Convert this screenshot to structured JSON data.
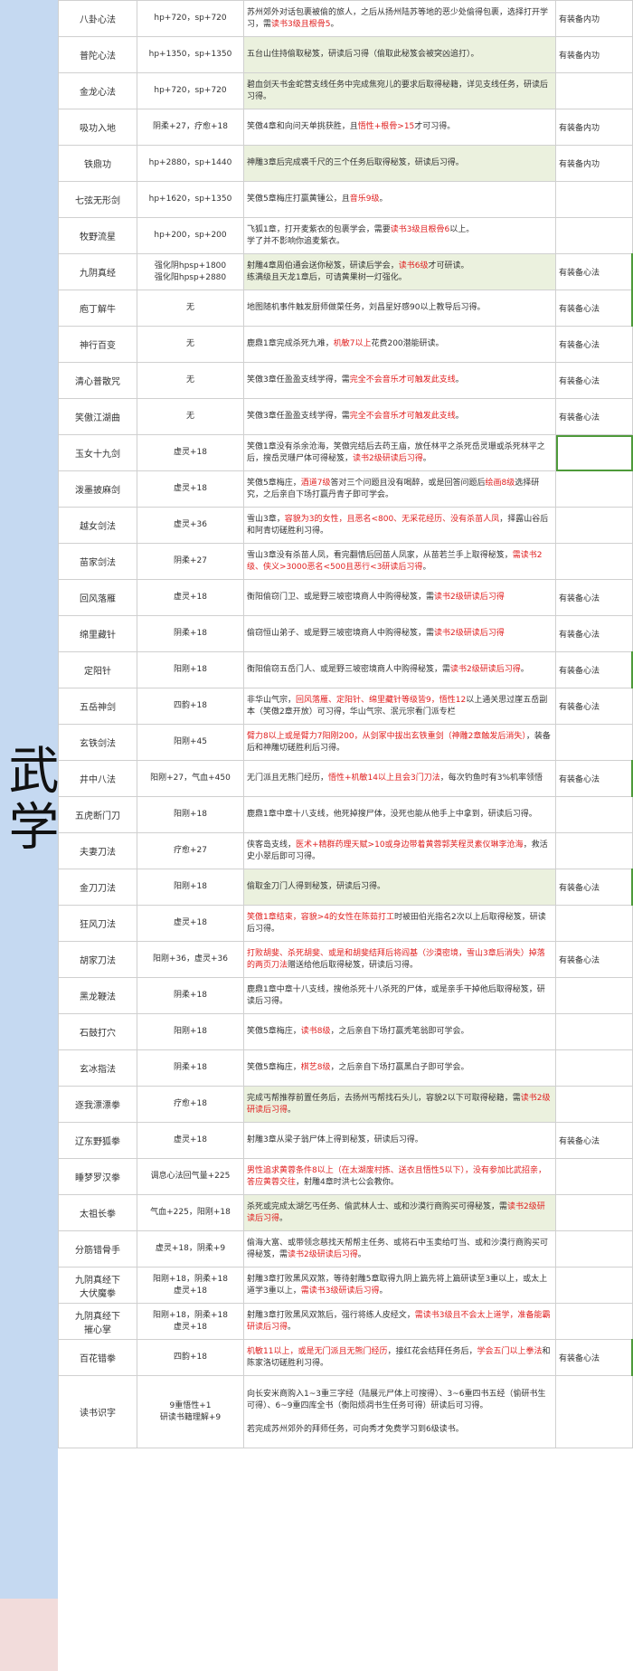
{
  "category_label": "武学",
  "rows": [
    {
      "name": "八卦心法",
      "attr": "hp+720，sp+720",
      "desc": [
        [
          "苏州郊外对话包裹被偷的旅人，之后从扬州陆苏等地的恶少处偷得包裹，选择打开学习，需",
          ""
        ],
        [
          "读书3级且根骨5",
          "r"
        ],
        [
          "。",
          ""
        ]
      ],
      "eq": "有装备内功",
      "g": false
    },
    {
      "name": "普陀心法",
      "attr": "hp+1350，sp+1350",
      "desc": [
        [
          "五台山住持偷取秘笈，研读后习得（偷取此秘笈会被突凶追打）。",
          ""
        ]
      ],
      "eq": "有装备内功",
      "g": true
    },
    {
      "name": "金龙心法",
      "attr": "hp+720，sp+720",
      "desc": [
        [
          "碧血剑天书金蛇营支线任务中完成焦宛儿的要求后取得秘籍，详见支线任务，研读后习得。",
          ""
        ]
      ],
      "eq": "",
      "g": true
    },
    {
      "name": "吸功入地",
      "attr": "阴柔+27，疗愈+18",
      "desc": [
        [
          "笑傲4章和向问天单挑获胜，且",
          ""
        ],
        [
          "悟性+根骨>15",
          "r"
        ],
        [
          "才可习得。",
          ""
        ]
      ],
      "eq": "有装备内功",
      "g": false
    },
    {
      "name": "铁鼎功",
      "attr": "hp+2880，sp+1440",
      "desc": [
        [
          "神雕3章后完成裘千尺的三个任务后取得秘笈，研读后习得。",
          ""
        ]
      ],
      "eq": "有装备内功",
      "g": true
    },
    {
      "name": "七弦无形剑",
      "attr": "hp+1620，sp+1350",
      "desc": [
        [
          "笑傲5章梅庄打赢黄锺公，且",
          ""
        ],
        [
          "音乐9级",
          "r"
        ],
        [
          "。",
          ""
        ]
      ],
      "eq": "",
      "g": false
    },
    {
      "name": "牧野流星",
      "attr": "hp+200，sp+200",
      "desc": [
        [
          "飞狐1章，打开麦紫衣的包裹学会，需要",
          ""
        ],
        [
          "读书3级且根骨6",
          "r"
        ],
        [
          "以上。",
          ""
        ],
        [
          "\n学了并不影响你追麦紫衣。",
          ""
        ]
      ],
      "eq": "",
      "g": false
    },
    {
      "name": "九阴真经",
      "attr": "强化阴hpsp+1800\n强化阳hpsp+2880",
      "desc": [
        [
          "射雕4章周伯通会送你秘笈，研读后学会，",
          ""
        ],
        [
          "读书6级",
          "r"
        ],
        [
          "才可研读。\n练满级且天龙1章后，可请黄果树一灯强化。",
          ""
        ]
      ],
      "eq": "有装备心法",
      "g": true,
      "mk": true
    },
    {
      "name": "庖丁解牛",
      "attr": "无",
      "desc": [
        [
          "地图随机事件触发厨师做菜任务，刘昌星好感90以上教导后习得。",
          ""
        ]
      ],
      "eq": "有装备心法",
      "g": false,
      "mk": true
    },
    {
      "name": "神行百变",
      "attr": "无",
      "desc": [
        [
          "鹿鼎1章完成杀死九难，",
          ""
        ],
        [
          "机敏7以上",
          "r"
        ],
        [
          "花费200潜能研读。",
          ""
        ]
      ],
      "eq": "有装备心法",
      "g": false
    },
    {
      "name": "清心普散咒",
      "attr": "无",
      "desc": [
        [
          "笑傲3章任盈盈支线学得，需",
          ""
        ],
        [
          "完全不会音乐才可触发此支线",
          "r"
        ],
        [
          "。",
          ""
        ]
      ],
      "eq": "有装备心法",
      "g": false
    },
    {
      "name": "笑傲江湖曲",
      "attr": "无",
      "desc": [
        [
          "笑傲3章任盈盈支线学得，需",
          ""
        ],
        [
          "完全不会音乐才可触发此支线",
          "r"
        ],
        [
          "。",
          ""
        ]
      ],
      "eq": "有装备心法",
      "g": false
    },
    {
      "name": "玉女十九剑",
      "attr": "虚灵+18",
      "desc": [
        [
          "笑傲1章没有杀余沧海，笑傲完结后去药王庙，放任林平之杀死岳灵珊或杀死林平之后，搜岳灵珊尸体可得秘笈，",
          ""
        ],
        [
          "读书2级研读后习得",
          "r"
        ],
        [
          "。",
          ""
        ]
      ],
      "eq": "",
      "g": false,
      "sel": true
    },
    {
      "name": "泼墨披麻剑",
      "attr": "虚灵+18",
      "desc": [
        [
          "笑傲5章梅庄，",
          ""
        ],
        [
          "酒道7级",
          "r"
        ],
        [
          "答对三个问题且没有喝醉，或是回答问题后",
          ""
        ],
        [
          "绘画8级",
          "r"
        ],
        [
          "选择研究，之后亲自下场打赢丹青子即可学会。",
          ""
        ]
      ],
      "eq": "",
      "g": false
    },
    {
      "name": "越女剑法",
      "attr": "虚灵+36",
      "desc": [
        [
          "雪山3章，",
          ""
        ],
        [
          "容貌为3的女性，且恶名<800、无采花经历、没有杀苗人凤",
          "r"
        ],
        [
          "，择露山谷后和阿青切磋胜利习得。",
          ""
        ]
      ],
      "eq": "",
      "g": false
    },
    {
      "name": "苗家剑法",
      "attr": "阴柔+27",
      "desc": [
        [
          "雪山3章没有杀苗人凤，看完翻情后回苗人凤家，从苗若兰手上取得秘笈，",
          ""
        ],
        [
          "需读书2级、侠义>3000恶名<500且恶行<3研读后习得",
          "r"
        ],
        [
          "。",
          ""
        ]
      ],
      "eq": "",
      "g": false
    },
    {
      "name": "回风落雁",
      "attr": "虚灵+18",
      "desc": [
        [
          "衡阳偷窃门卫、或是野三坡密境商人中购得秘笈，需",
          ""
        ],
        [
          "读书2级研读后习得",
          "r"
        ]
      ],
      "eq": "有装备心法",
      "g": false
    },
    {
      "name": "绵里藏针",
      "attr": "阴柔+18",
      "desc": [
        [
          "偷窃恒山弟子、或是野三坡密境商人中购得秘笈，需",
          ""
        ],
        [
          "读书2级研读后习得",
          "r"
        ]
      ],
      "eq": "有装备心法",
      "g": false
    },
    {
      "name": "定阳针",
      "attr": "阳刚+18",
      "desc": [
        [
          "衡阳偷窃五岳门人、或是野三坡密境商人中购得秘笈，需",
          ""
        ],
        [
          "读书2级研读后习得",
          "r"
        ],
        [
          "。",
          ""
        ]
      ],
      "eq": "有装备心法",
      "g": false,
      "mk": true
    },
    {
      "name": "五岳神剑",
      "attr": "四韵+18",
      "desc": [
        [
          "非华山气宗，",
          ""
        ],
        [
          "回风落雁、定阳针、绵里藏针等级皆9，悟性12",
          "r"
        ],
        [
          "以上通关思过崖五岳副本（笑傲2章开放）可习得，华山气宗、泯元宗看门派专栏",
          ""
        ]
      ],
      "eq": "有装备心法",
      "g": false
    },
    {
      "name": "玄铁剑法",
      "attr": "阳刚+45",
      "desc": [
        [
          "臂力8以上或是臂力7阳刚200，从剑冢中拔出玄铁重剑（神雕2章触发后消失）",
          "r"
        ],
        [
          "，装备后和神雕切磋胜利后习得。",
          ""
        ]
      ],
      "eq": "",
      "g": false
    },
    {
      "name": "井中八法",
      "attr": "阳刚+27，气血+450",
      "desc": [
        [
          "无门派且无熊门经历，",
          ""
        ],
        [
          "悟性+机敏14以上且会3门刀法",
          "r"
        ],
        [
          "，每次钓鱼时有3%机率领悟",
          ""
        ]
      ],
      "eq": "有装备心法",
      "g": false,
      "mk": true
    },
    {
      "name": "五虎断门刀",
      "attr": "阳刚+18",
      "desc": [
        [
          "鹿鼎1章中章十八支线，他死掉搜尸体，没死也能从他手上中拿到，研读后习得。",
          ""
        ]
      ],
      "eq": "",
      "g": false
    },
    {
      "name": "夫妻刀法",
      "attr": "疗愈+27",
      "desc": [
        [
          "侠客岛支线，",
          ""
        ],
        [
          "医术+精群药理天赋>10或身边带着黄蓉郭芙程灵素仪琳李沧海",
          "r"
        ],
        [
          "，救活史小翠后即可习得。",
          ""
        ]
      ],
      "eq": "",
      "g": false
    },
    {
      "name": "金刀刀法",
      "attr": "阳刚+18",
      "desc": [
        [
          "偷取金刀门人得到秘笈，研读后习得。",
          ""
        ]
      ],
      "eq": "有装备心法",
      "g": true,
      "mk": true
    },
    {
      "name": "狂风刀法",
      "attr": "虚灵+18",
      "desc": [
        [
          "笑傲1章结束，容貌>4的女性在陈茹打工",
          "r"
        ],
        [
          "时被田伯光指名2次以上后取得秘笈，研读后习得。",
          ""
        ]
      ],
      "eq": "",
      "g": false
    },
    {
      "name": "胡家刀法",
      "attr": "阳刚+36，虚灵+36",
      "desc": [
        [
          "打败胡斐、杀死胡斐、或是和胡斐结拜后将阎基（沙漠密境，雪山3章后消失）掉落的两页刀法",
          "r"
        ],
        [
          "赠送给他后取得秘笈，研读后习得。",
          ""
        ]
      ],
      "eq": "有装备心法",
      "g": false
    },
    {
      "name": "黑龙鞭法",
      "attr": "阴柔+18",
      "desc": [
        [
          "鹿鼎1章中章十八支线，搜他杀死十八杀死的尸体，或是亲手干掉他后取得秘笈，研读后习得。",
          ""
        ]
      ],
      "eq": "",
      "g": false
    },
    {
      "name": "石鼓打穴",
      "attr": "阳刚+18",
      "desc": [
        [
          "笑傲5章梅庄，",
          ""
        ],
        [
          "读书8级",
          "r"
        ],
        [
          "，之后亲自下场打赢秃笔翁即可学会。",
          ""
        ]
      ],
      "eq": "",
      "g": false
    },
    {
      "name": "玄冰指法",
      "attr": "阴柔+18",
      "desc": [
        [
          "笑傲5章梅庄，",
          ""
        ],
        [
          "棋艺8级",
          "r"
        ],
        [
          "，之后亲自下场打赢黑白子即可学会。",
          ""
        ]
      ],
      "eq": "",
      "g": false
    },
    {
      "name": "逐我漂漂拳",
      "attr": "疗愈+18",
      "desc": [
        [
          "完成丐帮推荐前置任务后，去扬州丐帮找石头儿，容貌2以下可取得秘籍，需",
          ""
        ],
        [
          "读书2级研读后习得",
          "r"
        ],
        [
          "。",
          ""
        ]
      ],
      "eq": "",
      "g": true
    },
    {
      "name": "辽东野狐拳",
      "attr": "虚灵+18",
      "desc": [
        [
          "射雕3章从梁子翁尸体上得到秘笈，研读后习得。",
          ""
        ]
      ],
      "eq": "有装备心法",
      "g": false
    },
    {
      "name": "睡梦罗汉拳",
      "attr": "调息心法回气量+225",
      "desc": [
        [
          "男性追求黄蓉条件8以上（在太湖废村拣、送衣且悟性5以下），没有参加比武招亲，答应黄蓉交往",
          "r"
        ],
        [
          "，射雕4章时洪七公会教你。",
          ""
        ]
      ],
      "eq": "",
      "g": false
    },
    {
      "name": "太祖长拳",
      "attr": "气血+225，阳刚+18",
      "desc": [
        [
          "杀死或完成太湖乞丐任务、偷武林人士、或和沙漠行商购买可得秘笈，需",
          ""
        ],
        [
          "读书2级研读后习得",
          "r"
        ],
        [
          "。",
          ""
        ]
      ],
      "eq": "",
      "g": true
    },
    {
      "name": "分筋错骨手",
      "attr": "虚灵+18，阴柔+9",
      "desc": [
        [
          "偷海大富、或带领念慈找天帮帮主任务、或将石中玉卖给叮当、或和沙漠行商购买可得秘笈，需",
          ""
        ],
        [
          "读书2级研读后习得",
          "r"
        ],
        [
          "。",
          ""
        ]
      ],
      "eq": "",
      "g": false
    },
    {
      "name": "九阴真经下\n大伏魔拳",
      "attr": "阳刚+18，阴柔+18\n虚灵+18",
      "desc": [
        [
          "射雕3章打败黑风双煞，等待射雕5章取得九阴上篇先将上篇研读至3重以上，或太上道学3重以上，",
          ""
        ],
        [
          "需读书3级研读后习得",
          "r"
        ],
        [
          "。",
          ""
        ]
      ],
      "eq": "",
      "g": false
    },
    {
      "name": "九阴真经下\n摧心掌",
      "attr": "阳刚+18，阴柔+18\n虚灵+18",
      "desc": [
        [
          "射雕3章打败黑风双煞后，强行将练人皮经文，",
          ""
        ],
        [
          "需读书3级且不会太上道学，准备能霸研读后习得",
          "r"
        ],
        [
          "。",
          ""
        ]
      ],
      "eq": "",
      "g": false
    },
    {
      "name": "百花错拳",
      "attr": "四韵+18",
      "desc": [
        [
          "机敏11以上，或是无门派且无熊门经历",
          "r"
        ],
        [
          "，接红花会结拜任务后，",
          ""
        ],
        [
          "学会五门以上拳法",
          "r"
        ],
        [
          "和陈家洛切磋胜利习得。",
          ""
        ]
      ],
      "eq": "有装备心法",
      "g": false,
      "mk": true
    },
    {
      "name": "读书识字",
      "attr": "9重悟性+1\n研读书籍理解+9",
      "desc": [
        [
          "向长安米商购入1~3重三字经（陆展元尸体上可搜得）、3~6重四书五经（偷研书生可得）、6~9重四库全书（衡阳烦凋书生任务可得）研读后可习得。\n\n若完成苏州郊外的拜师任务，可向秀才免费学习到6级读书。",
          ""
        ]
      ],
      "eq": "",
      "g": false
    }
  ]
}
